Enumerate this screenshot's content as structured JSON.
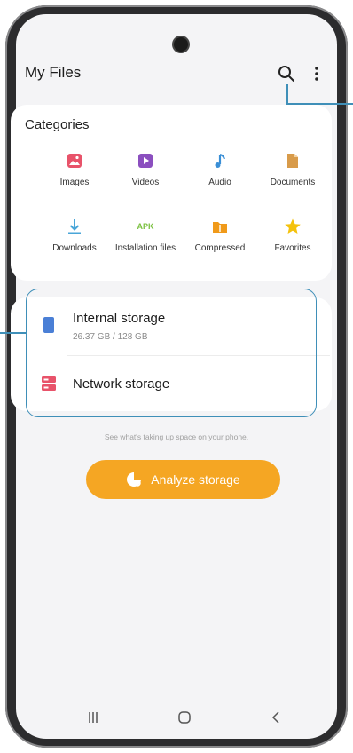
{
  "app": {
    "title": "My Files"
  },
  "categories": {
    "title": "Categories",
    "items": [
      {
        "label": "Images",
        "icon": "image-icon",
        "color": "#e8536a"
      },
      {
        "label": "Videos",
        "icon": "video-icon",
        "color": "#8b4fbf"
      },
      {
        "label": "Audio",
        "icon": "audio-icon",
        "color": "#3a8fd6"
      },
      {
        "label": "Documents",
        "icon": "document-icon",
        "color": "#d89b4a"
      },
      {
        "label": "Downloads",
        "icon": "download-icon",
        "color": "#4aa6d8"
      },
      {
        "label": "Installation files",
        "icon": "apk-icon",
        "color": "#7cc142",
        "badge": "APK"
      },
      {
        "label": "Compressed",
        "icon": "folder-zip-icon",
        "color": "#f09a1a"
      },
      {
        "label": "Favorites",
        "icon": "star-icon",
        "color": "#f4c20d"
      }
    ]
  },
  "storage": {
    "internal": {
      "title": "Internal storage",
      "subtitle": "26.37 GB / 128 GB"
    },
    "network": {
      "title": "Network storage"
    }
  },
  "analyze": {
    "hint": "See what's taking up space on your phone.",
    "button_label": "Analyze storage"
  },
  "colors": {
    "accent": "#f5a623",
    "callout": "#3f8fb8"
  }
}
